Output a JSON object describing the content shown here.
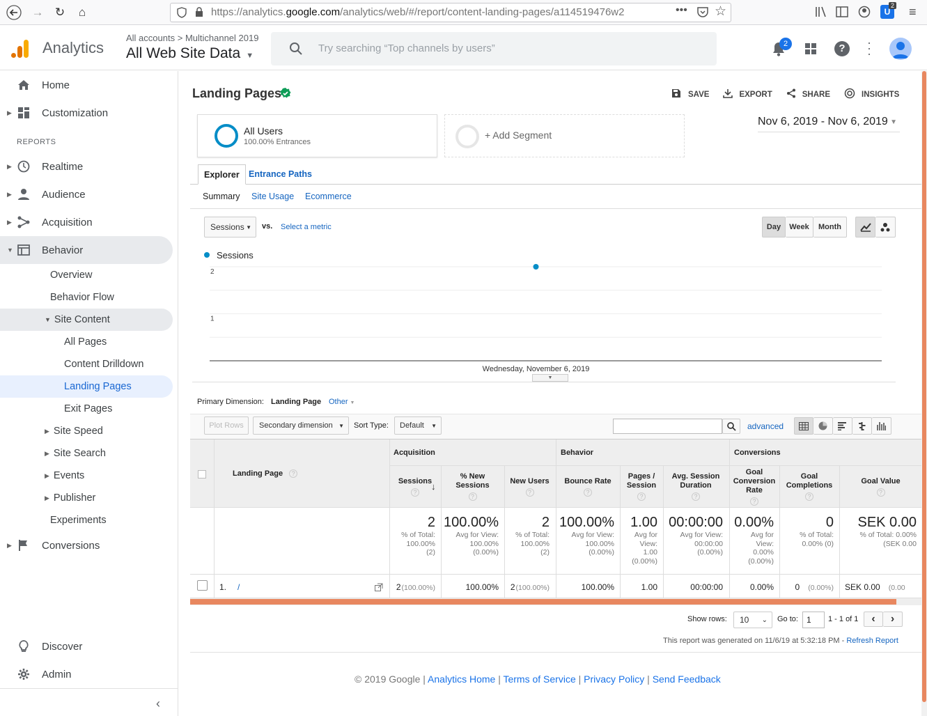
{
  "browser": {
    "url_prefix": "https://analytics.",
    "url_domain": "google.com",
    "url_path": "/analytics/web/#/report/content-landing-pages/a114519476w2",
    "badge_count": "2"
  },
  "header": {
    "app_name": "Analytics",
    "breadcrumb_root": "All accounts",
    "breadcrumb_sep": ">",
    "breadcrumb_account": "Multichannel 2019",
    "view_name": "All Web Site Data",
    "search_placeholder": "Try searching “Top channels by users”",
    "notification_count": "2"
  },
  "sidebar": {
    "home": "Home",
    "customization": "Customization",
    "reports_heading": "REPORTS",
    "realtime": "Realtime",
    "audience": "Audience",
    "acquisition": "Acquisition",
    "behavior": "Behavior",
    "behavior_items": [
      "Overview",
      "Behavior Flow"
    ],
    "site_content": "Site Content",
    "site_content_items": [
      "All Pages",
      "Content Drilldown",
      "Landing Pages",
      "Exit Pages"
    ],
    "behavior_sub2": [
      "Site Speed",
      "Site Search",
      "Events",
      "Publisher"
    ],
    "experiments": "Experiments",
    "conversions": "Conversions",
    "discover": "Discover",
    "admin": "Admin"
  },
  "report": {
    "title": "Landing Pages",
    "actions": {
      "save": "SAVE",
      "export": "EXPORT",
      "share": "SHARE",
      "insights": "INSIGHTS"
    },
    "segment": {
      "name": "All Users",
      "sub": "100.00% Entrances",
      "add": "+ Add Segment"
    },
    "date_range": "Nov 6, 2019 - Nov 6, 2019",
    "tabs": [
      "Explorer",
      "Entrance Paths"
    ],
    "subtabs": [
      "Summary",
      "Site Usage",
      "Ecommerce"
    ],
    "metric_select": "Sessions",
    "vs": "vs.",
    "select_metric": "Select a metric",
    "period_buttons": [
      "Day",
      "Week",
      "Month"
    ]
  },
  "chart_data": {
    "type": "scatter",
    "series": [
      {
        "name": "Sessions",
        "x": [
          "Wednesday, November 6, 2019"
        ],
        "values": [
          2
        ]
      }
    ],
    "ytick_labels": [
      "2",
      "1"
    ],
    "ylim": [
      0,
      2
    ],
    "xlabel": "Wednesday, November 6, 2019",
    "color": "#058dc7"
  },
  "table_controls": {
    "primary_dimension_label": "Primary Dimension:",
    "primary_dimension": "Landing Page",
    "other": "Other",
    "plot_rows": "Plot Rows",
    "secondary_dimension": "Secondary dimension",
    "sort_type_label": "Sort Type:",
    "sort_type": "Default",
    "advanced": "advanced"
  },
  "table": {
    "groups": [
      "Acquisition",
      "Behavior",
      "Conversions"
    ],
    "dim_header": "Landing Page",
    "columns": [
      {
        "l1": "Sessions",
        "l2": ""
      },
      {
        "l1": "% New",
        "l2": "Sessions"
      },
      {
        "l1": "New Users",
        "l2": ""
      },
      {
        "l1": "Bounce Rate",
        "l2": ""
      },
      {
        "l1": "Pages /",
        "l2": "Session"
      },
      {
        "l1": "Avg. Session",
        "l2": "Duration"
      },
      {
        "l1": "Goal",
        "l2": "Conversion",
        "l3": "Rate"
      },
      {
        "l1": "Goal",
        "l2": "Completions"
      },
      {
        "l1": "Goal Value",
        "l2": ""
      }
    ],
    "totals": [
      {
        "big": "2",
        "lines": [
          "% of Total:",
          "100.00%",
          "(2)"
        ]
      },
      {
        "big": "100.00%",
        "lines": [
          "Avg for View:",
          "100.00%",
          "(0.00%)"
        ]
      },
      {
        "big": "2",
        "lines": [
          "% of Total:",
          "100.00%",
          "(2)"
        ]
      },
      {
        "big": "100.00%",
        "lines": [
          "Avg for View:",
          "100.00%",
          "(0.00%)"
        ]
      },
      {
        "big": "1.00",
        "lines": [
          "Avg for",
          "View:",
          "1.00",
          "(0.00%)"
        ]
      },
      {
        "big": "00:00:00",
        "lines": [
          "Avg for View:",
          "00:00:00",
          "(0.00%)"
        ]
      },
      {
        "big": "0.00%",
        "lines": [
          "Avg for",
          "View:",
          "0.00%",
          "(0.00%)"
        ]
      },
      {
        "big": "0",
        "lines": [
          "% of Total:",
          "0.00% (0)"
        ]
      },
      {
        "big": "SEK 0.00",
        "lines": [
          "% of Total: 0.00%",
          "(SEK 0.00"
        ]
      }
    ],
    "row": {
      "index": "1.",
      "page": "/",
      "cells": [
        {
          "main": "2",
          "sub": "(100.00%)"
        },
        {
          "main": "100.00%",
          "sub": ""
        },
        {
          "main": "2",
          "sub": "(100.00%)"
        },
        {
          "main": "100.00%",
          "sub": ""
        },
        {
          "main": "1.00",
          "sub": ""
        },
        {
          "main": "00:00:00",
          "sub": ""
        },
        {
          "main": "0.00%",
          "sub": ""
        },
        {
          "main": "0",
          "sub": "(0.00%)"
        },
        {
          "main": "SEK 0.00",
          "sub": "(0.00"
        }
      ]
    }
  },
  "pagination": {
    "show_rows_label": "Show rows:",
    "show_rows": "10",
    "goto_label": "Go to:",
    "goto_value": "1",
    "range": "1 - 1 of 1"
  },
  "generated": {
    "text": "This report was generated on 11/6/19 at 5:32:18 PM -",
    "refresh": "Refresh Report"
  },
  "footer": {
    "copyright": "© 2019 Google",
    "links": [
      "Analytics Home",
      "Terms of Service",
      "Privacy Policy",
      "Send Feedback"
    ]
  }
}
